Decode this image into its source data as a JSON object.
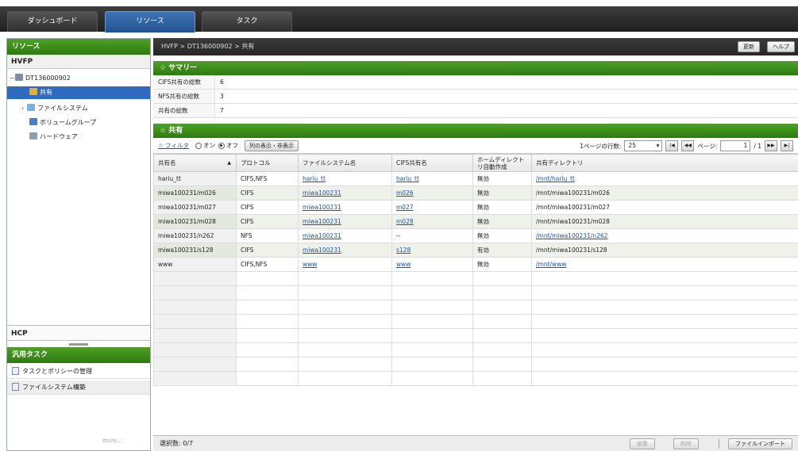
{
  "tabs": [
    {
      "label": "ダッシュボード"
    },
    {
      "label": "リソース"
    },
    {
      "label": "タスク"
    }
  ],
  "left": {
    "title": "リソース",
    "root": "HVFP",
    "tree": {
      "host": "DT136000902",
      "items": [
        {
          "label": "共有",
          "icon": "share-icon"
        },
        {
          "label": "ファイルシステム",
          "icon": "filesystem-icon"
        },
        {
          "label": "ボリュームグループ",
          "icon": "volume-group-icon"
        },
        {
          "label": "ハードウェア",
          "icon": "hardware-icon"
        }
      ]
    },
    "hcp": "HCP",
    "tasks_title": "汎用タスク",
    "tasks": [
      {
        "label": "タスクとポリシーの管理"
      },
      {
        "label": "ファイルシステム構築"
      }
    ],
    "more": "more..."
  },
  "breadcrumb": "HVFP >  DT136000902 >  共有",
  "header_buttons": {
    "refresh": "更新",
    "help": "ヘルプ"
  },
  "summary": {
    "title": "☆ サマリー",
    "rows": [
      {
        "key": "CIFS共有の総数",
        "value": "6"
      },
      {
        "key": "NFS共有の総数",
        "value": "3"
      },
      {
        "key": "共有の総数",
        "value": "7"
      }
    ]
  },
  "shares": {
    "title": "☆ 共有",
    "filter_label": "☆ フィルタ",
    "radio_off": "オン",
    "radio_on": "オフ",
    "column_toggle": "列の表示・非表示",
    "rows_per_page_label": "1ページの行数:",
    "rows_per_page": "25",
    "page_label": "ページ:",
    "page_value": "1",
    "page_total": "/ 1",
    "columns": [
      "共有名",
      "プロトコル",
      "ファイルシステム名",
      "CIFS共有名",
      "ホームディレクト リ自動作成",
      "共有ディレクトリ"
    ],
    "rows": [
      {
        "name": "hariu_tt",
        "protocol": "CIFS,NFS",
        "fs": "hariu_tt",
        "cifs": "hariu_tt",
        "home": "無効",
        "dir": "/mnt/hariu_tt",
        "dir_link": true
      },
      {
        "name": "miwa100231/m026",
        "protocol": "CIFS",
        "fs": "miwa100231",
        "cifs": "m026",
        "home": "無効",
        "dir": "/mnt/miwa100231/m026",
        "dir_link": false
      },
      {
        "name": "miwa100231/m027",
        "protocol": "CIFS",
        "fs": "miwa100231",
        "cifs": "m027",
        "home": "無効",
        "dir": "/mnt/miwa100231/m027",
        "dir_link": false
      },
      {
        "name": "miwa100231/m028",
        "protocol": "CIFS",
        "fs": "miwa100231",
        "cifs": "m028",
        "home": "無効",
        "dir": "/mnt/miwa100231/m028",
        "dir_link": false
      },
      {
        "name": "miwa100231/n262",
        "protocol": "NFS",
        "fs": "miwa100231",
        "cifs": "--",
        "home": "無効",
        "dir": "/mnt/miwa100231/n262",
        "dir_link": true
      },
      {
        "name": "miwa100231/s128",
        "protocol": "CIFS",
        "fs": "miwa100231",
        "cifs": "s128",
        "home": "有効",
        "dir": "/mnt/miwa100231/s128",
        "dir_link": false
      },
      {
        "name": "www",
        "protocol": "CIFS,NFS",
        "fs": "www",
        "cifs": "www",
        "home": "無効",
        "dir": "/mnt/www",
        "dir_link": true
      }
    ]
  },
  "footer": {
    "selected_label": "選択数:",
    "selected_value": "0/7",
    "btn_edit": "編集",
    "btn_delete": "削除",
    "btn_export": "ファイルインポート"
  }
}
